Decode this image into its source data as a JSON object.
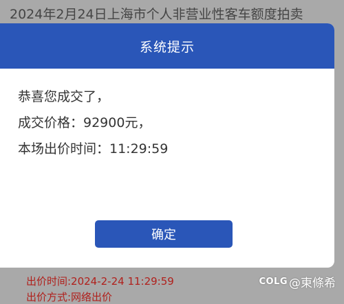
{
  "background": {
    "title": "2024年2月24日上海市个人非营业性客车额度拍卖",
    "bid_time_line": "出价时间:2024-2-24 11:29:59",
    "bid_method_line": "出价方式:网络出价"
  },
  "dialog": {
    "title": "系统提示",
    "lines": [
      "恭喜您成交了，",
      "成交价格：92900元，",
      "本场出价时间：11:29:59"
    ],
    "confirm_label": "确定"
  },
  "watermark": {
    "logo": "COLG",
    "text": "@東條希"
  },
  "colors": {
    "accent": "#2a56b8",
    "overlay": "#a9a9a9",
    "alert_text": "#b0201c"
  }
}
